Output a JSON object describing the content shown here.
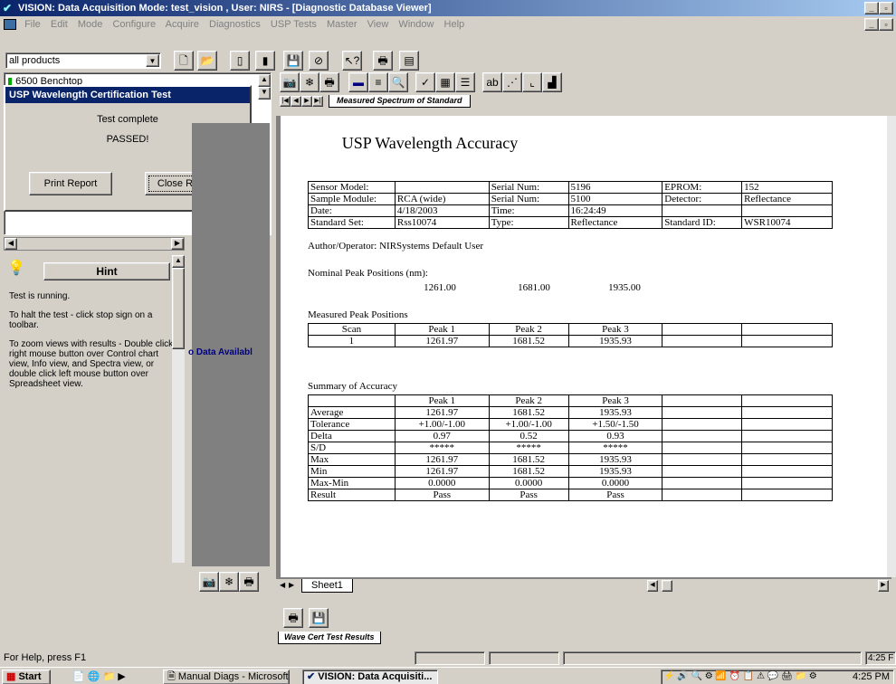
{
  "window": {
    "title": "VISION: Data Acquisition Mode: test_vision , User: NIRS - [Diagnostic Database Viewer]"
  },
  "menu": [
    "File",
    "Edit",
    "Mode",
    "Configure",
    "Acquire",
    "Diagnostics",
    "USP Tests",
    "Master",
    "View",
    "Window",
    "Help"
  ],
  "product_combo": {
    "value": "all products"
  },
  "tree": {
    "item": "6500 Benchtop"
  },
  "dialog": {
    "title": "USP Wavelength Certification Test",
    "status": "Test complete",
    "result": "PASSED!",
    "print_button": "Print Report",
    "close_button": "Close Report"
  },
  "hint": {
    "title": "Hint",
    "lines": [
      "Test is running.",
      "To halt the test - click stop sign on a toolbar.",
      "To zoom views with results - Double click right mouse button over Control chart view, Info view, and Spectra view, or double click left mouse button over Spreadsheet view."
    ]
  },
  "no_data_text": "o Data Availabl",
  "view_tab": "Measured Spectrum of Standard",
  "report": {
    "title": "USP Wavelength Accuracy",
    "info_rows": [
      [
        "Sensor Model:",
        "",
        "Serial Num:",
        "5196",
        "EPROM:",
        "152"
      ],
      [
        "Sample Module:",
        "RCA (wide)",
        "Serial Num:",
        "5100",
        "Detector:",
        "Reflectance"
      ],
      [
        "Date:",
        "4/18/2003",
        "Time:",
        "16:24:49",
        "",
        ""
      ],
      [
        "Standard Set:",
        "Rss10074",
        "Type:",
        "Reflectance",
        "Standard ID:",
        "WSR10074"
      ]
    ],
    "author": "Author/Operator:  NIRSystems Default User",
    "nominal_label": "Nominal Peak Positions (nm):",
    "nominal_values": [
      "1261.00",
      "1681.00",
      "1935.00"
    ],
    "measured_label": "Measured Peak Positions",
    "measured_rows": [
      [
        "Scan",
        "Peak 1",
        "Peak 2",
        "Peak 3",
        "",
        ""
      ],
      [
        "1",
        "1261.97",
        "1681.52",
        "1935.93",
        "",
        ""
      ]
    ],
    "summary_label": "Summary of Accuracy",
    "summary_rows": [
      [
        "",
        "Peak 1",
        "Peak 2",
        "Peak 3",
        "",
        ""
      ],
      [
        "Average",
        "1261.97",
        "1681.52",
        "1935.93",
        "",
        ""
      ],
      [
        "Tolerance",
        "+1.00/-1.00",
        "+1.00/-1.00",
        "+1.50/-1.50",
        "",
        ""
      ],
      [
        "Delta",
        "0.97",
        "0.52",
        "0.93",
        "",
        ""
      ],
      [
        "S/D",
        "*****",
        "*****",
        "*****",
        "",
        ""
      ],
      [
        "Max",
        "1261.97",
        "1681.52",
        "1935.93",
        "",
        ""
      ],
      [
        "Min",
        "1261.97",
        "1681.52",
        "1935.93",
        "",
        ""
      ],
      [
        "Max-Min",
        "0.0000",
        "0.0000",
        "0.0000",
        "",
        ""
      ],
      [
        "Result",
        "Pass",
        "Pass",
        "Pass",
        "",
        ""
      ]
    ]
  },
  "sheet_tab": "Sheet1",
  "results_tab": "Wave Cert Test Results",
  "status": {
    "help": "For Help, press F1",
    "time": "4:25 F"
  },
  "taskbar": {
    "start": "Start",
    "tasks": [
      "Manual Diags - Microsoft ...",
      "VISION: Data Acquisiti..."
    ],
    "clock": "4:25 PM"
  }
}
